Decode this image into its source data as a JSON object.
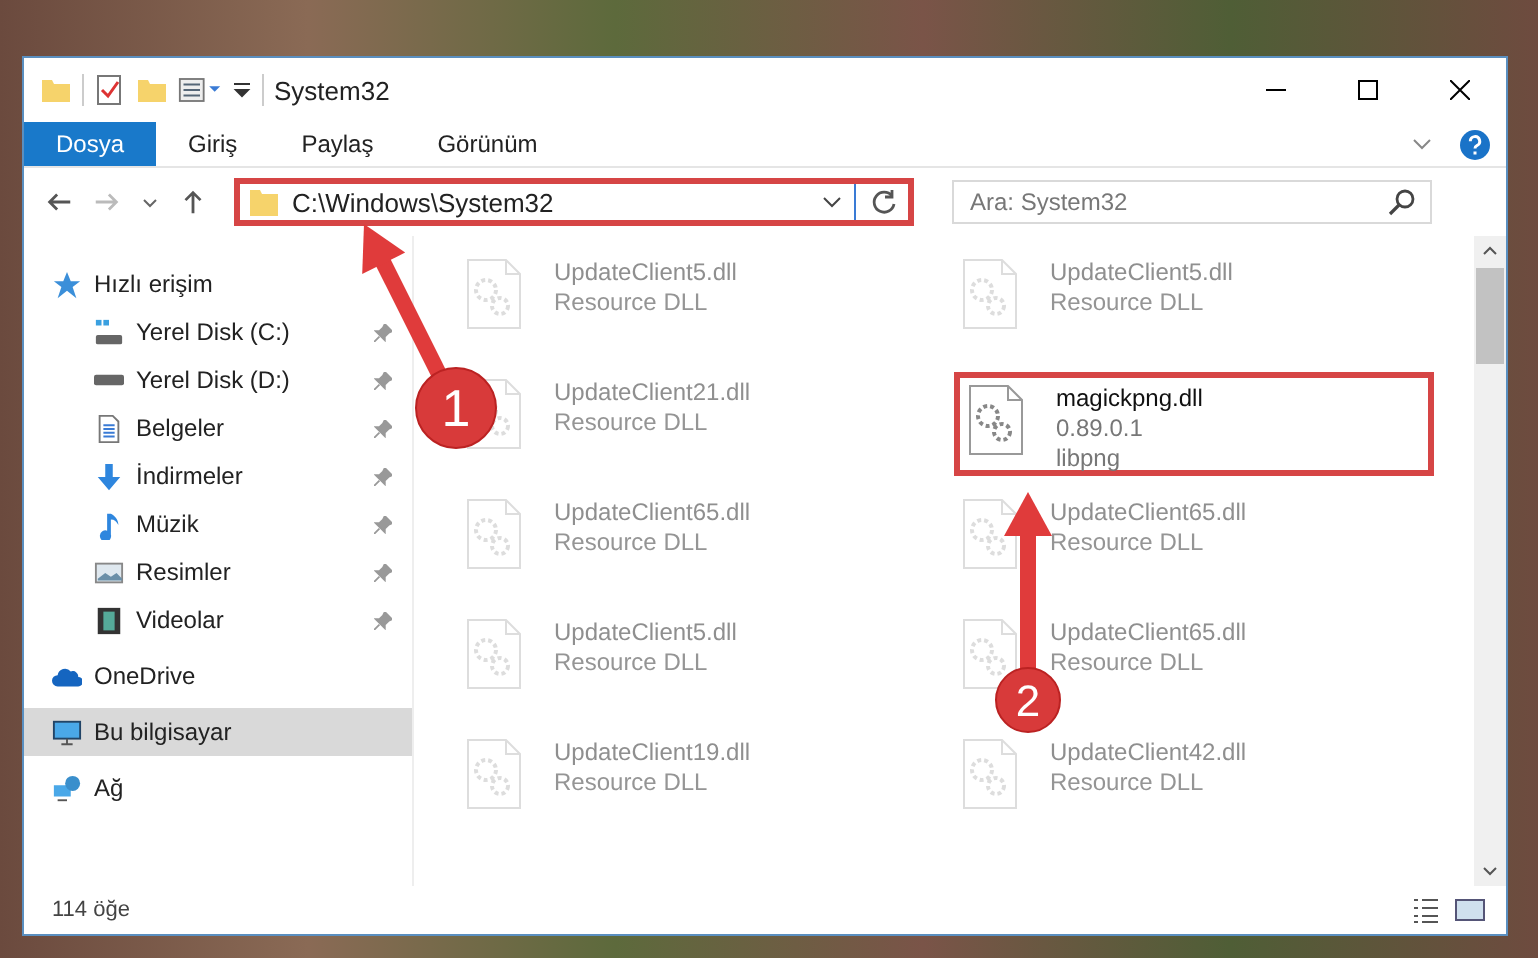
{
  "window": {
    "title": "System32"
  },
  "ribbon_tabs": [
    {
      "label": "Dosya",
      "selected": true
    },
    {
      "label": "Giriş",
      "selected": false
    },
    {
      "label": "Paylaş",
      "selected": false
    },
    {
      "label": "Görünüm",
      "selected": false
    }
  ],
  "address": {
    "value": "C:\\Windows\\System32",
    "highlighted": true
  },
  "search": {
    "placeholder": "Ara: System32"
  },
  "nav": [
    {
      "label": "Hızlı erişim",
      "kind": "star",
      "selected": false,
      "children": [
        {
          "label": "Yerel Disk (C:)",
          "kind": "system-drive",
          "pinned": true,
          "selected": false
        },
        {
          "label": "Yerel Disk (D:)",
          "kind": "drive",
          "pinned": true,
          "selected": false
        },
        {
          "label": "Belgeler",
          "kind": "documents",
          "pinned": true,
          "selected": false
        },
        {
          "label": "İndirmeler",
          "kind": "downloads",
          "pinned": true,
          "selected": false
        },
        {
          "label": "Müzik",
          "kind": "music",
          "pinned": true,
          "selected": false
        },
        {
          "label": "Resimler",
          "kind": "pictures",
          "pinned": true,
          "selected": false
        },
        {
          "label": "Videolar",
          "kind": "videos",
          "pinned": true,
          "selected": false
        }
      ]
    },
    {
      "label": "OneDrive",
      "kind": "cloud",
      "selected": false
    },
    {
      "label": "Bu bilgisayar",
      "kind": "computer",
      "selected": true
    },
    {
      "label": "Ağ",
      "kind": "network",
      "selected": false
    }
  ],
  "files": [
    {
      "name": "UpdateClient5.dll",
      "details": [
        "Resource DLL"
      ],
      "faded": true,
      "highlighted": false
    },
    {
      "name": "UpdateClient5.dll",
      "details": [
        "Resource DLL"
      ],
      "faded": true,
      "highlighted": false
    },
    {
      "name": "UpdateClient21.dll",
      "details": [
        "Resource DLL"
      ],
      "faded": true,
      "highlighted": false
    },
    {
      "name": "magickpng.dll",
      "details": [
        "0.89.0.1",
        "libpng"
      ],
      "faded": false,
      "highlighted": true
    },
    {
      "name": "UpdateClient65.dll",
      "details": [
        "Resource DLL"
      ],
      "faded": true,
      "highlighted": false
    },
    {
      "name": "UpdateClient65.dll",
      "details": [
        "Resource DLL"
      ],
      "faded": true,
      "highlighted": false
    },
    {
      "name": "UpdateClient5.dll",
      "details": [
        "Resource DLL"
      ],
      "faded": true,
      "highlighted": false
    },
    {
      "name": "UpdateClient65.dll",
      "details": [
        "Resource DLL"
      ],
      "faded": true,
      "highlighted": false
    },
    {
      "name": "UpdateClient19.dll",
      "details": [
        "Resource DLL"
      ],
      "faded": true,
      "highlighted": false
    },
    {
      "name": "UpdateClient42.dll",
      "details": [
        "Resource DLL"
      ],
      "faded": true,
      "highlighted": false
    }
  ],
  "status_bar": {
    "count": "114 öğe"
  },
  "annotations": [
    {
      "number": "1"
    },
    {
      "number": "2"
    }
  ]
}
